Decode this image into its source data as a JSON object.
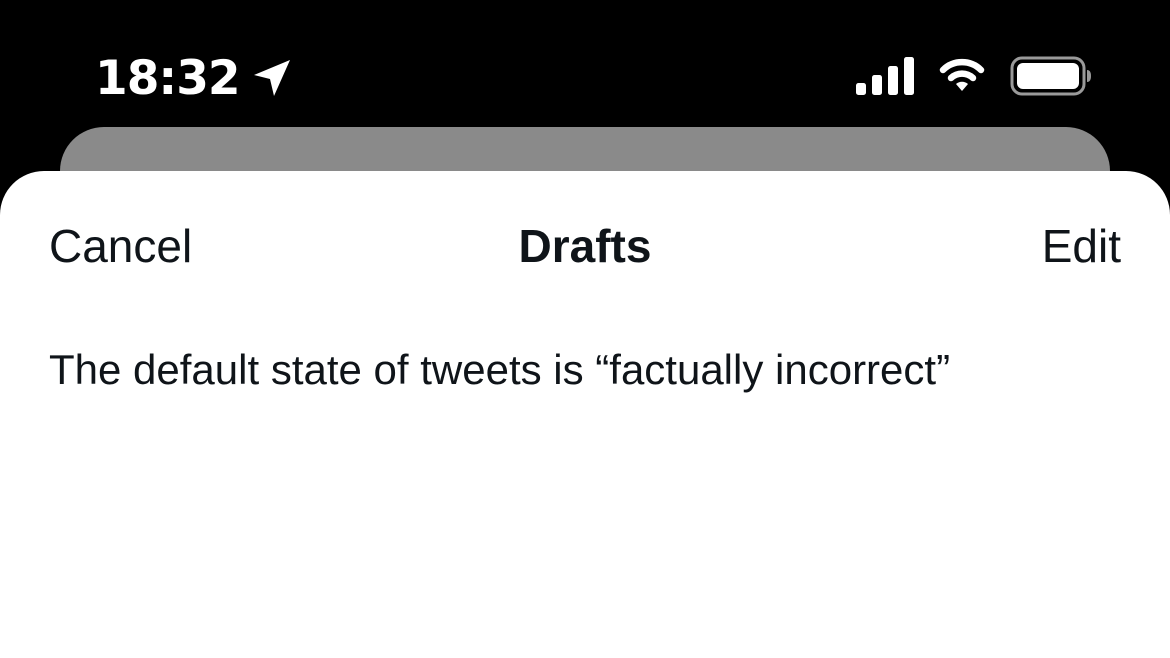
{
  "status_bar": {
    "time": "18:32",
    "icons": [
      "location-arrow-icon",
      "cellular-signal-icon",
      "wifi-icon",
      "battery-icon"
    ]
  },
  "nav": {
    "cancel_label": "Cancel",
    "title": "Drafts",
    "edit_label": "Edit"
  },
  "drafts": [
    {
      "text": "The default state of tweets is “factually incorrect”"
    }
  ],
  "colors": {
    "status_bar_bg": "#000000",
    "backdrop_sheet": "#8a8a8a",
    "sheet_bg": "#ffffff",
    "text": "#0f1419"
  }
}
